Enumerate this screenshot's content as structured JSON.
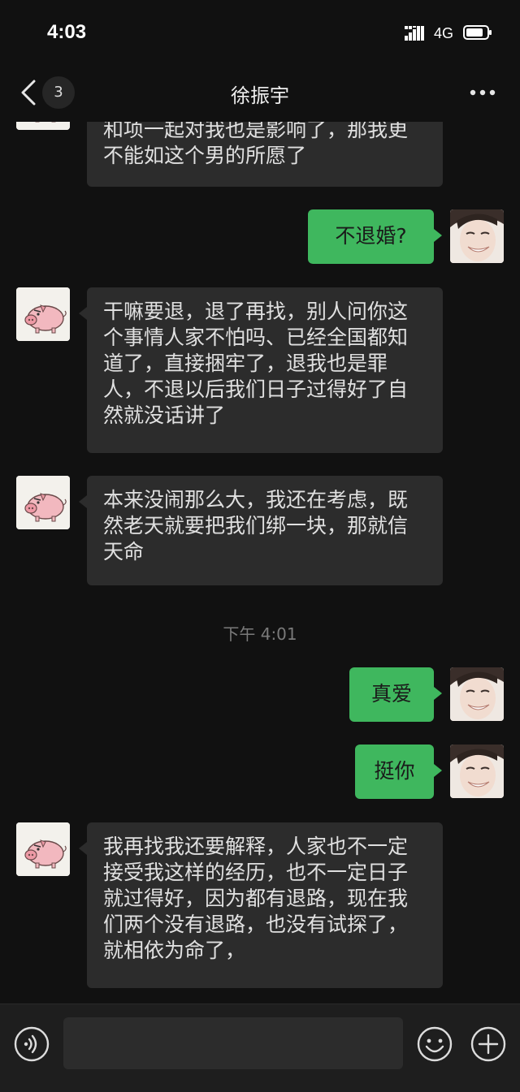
{
  "status_bar": {
    "time": "4:03",
    "network": "4G"
  },
  "nav": {
    "unread_count": "3",
    "title": "徐振宇"
  },
  "messages": [
    {
      "side": "in",
      "text": "和项一起对我也是影响了，那我更不能如这个男的所愿了"
    },
    {
      "side": "out",
      "text": "不退婚?"
    },
    {
      "side": "in",
      "text": "干嘛要退，退了再找，别人问你这个事情人家不怕吗、已经全国都知道了，直接捆牢了，退我也是罪人，不退以后我们日子过得好了自然就没话讲了"
    },
    {
      "side": "in",
      "text": "本来没闹那么大，我还在考虑，既然老天就要把我们绑一块，那就信天命"
    },
    {
      "side": "out",
      "text": "真爱"
    },
    {
      "side": "out",
      "text": "挺你"
    },
    {
      "side": "in",
      "text": "我再找我还要解释，人家也不一定接受我这样的经历，也不一定日子就过得好，因为都有退路，现在我们两个没有退路，也没有试探了，就相依为命了，"
    }
  ],
  "timestamp": "下午 4:01",
  "input_bar": {
    "value": "",
    "icons": [
      "voice-icon",
      "emoji-icon",
      "plus-icon"
    ]
  },
  "colors": {
    "background": "#111111",
    "incoming_bubble": "#2c2c2c",
    "outgoing_bubble": "#3fb75e"
  }
}
